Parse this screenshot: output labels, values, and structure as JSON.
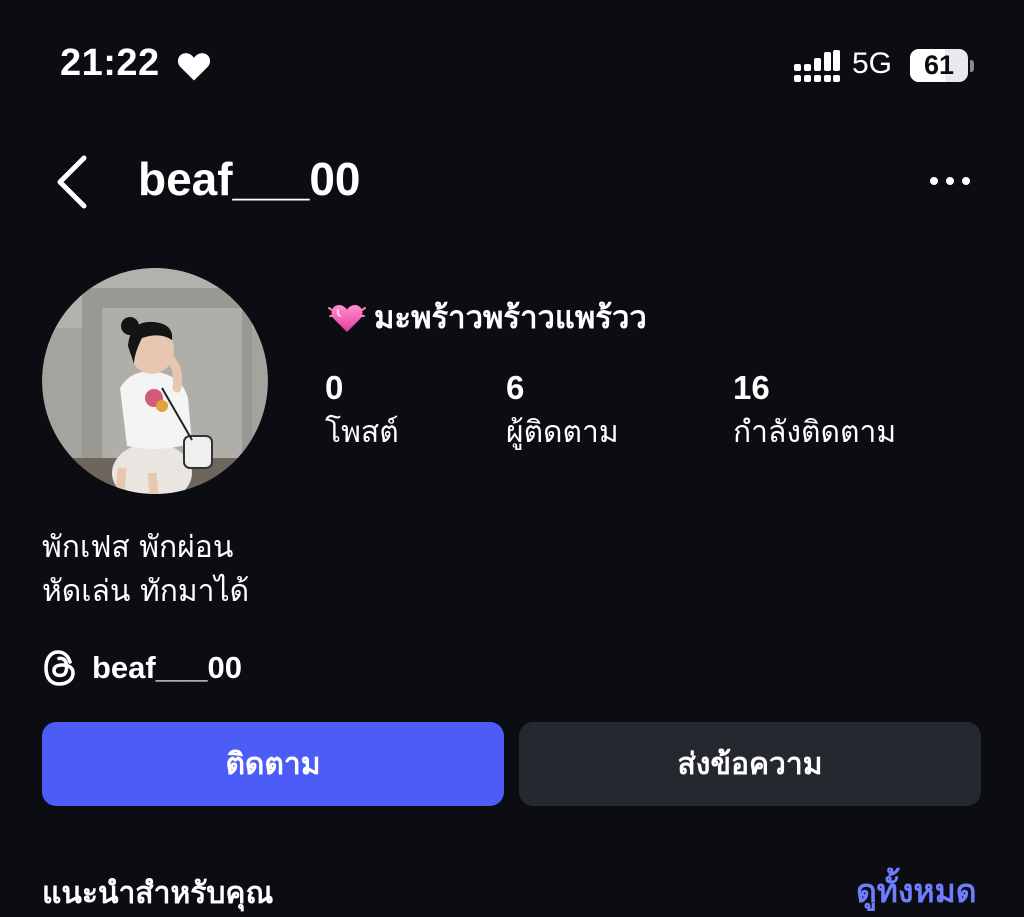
{
  "status_bar": {
    "time": "21:22",
    "heart_icon": "heart-icon",
    "signal_icon": "cellular-signal-icon",
    "network": "5G",
    "battery_level": 61,
    "battery_label": "61"
  },
  "header": {
    "back_icon": "chevron-left-icon",
    "username": "beaf___00",
    "more_icon": "more-horizontal-icon"
  },
  "profile": {
    "avatar_icon": "profile-photo",
    "name_emoji": "💓",
    "display_name": "มะพร้าวพร้าวแพร้วว",
    "stats": {
      "posts": {
        "value": "0",
        "label": "โพสต์"
      },
      "followers": {
        "value": "6",
        "label": "ผู้ติดตาม"
      },
      "following": {
        "value": "16",
        "label": "กำลังติดตาม"
      }
    },
    "bio_lines": [
      "พักเฟส พักผ่อน",
      "หัดเล่น ทักมาได้"
    ],
    "threads_icon": "threads-icon",
    "threads_handle": "beaf___00"
  },
  "actions": {
    "follow_label": "ติดตาม",
    "message_label": "ส่งข้อความ"
  },
  "suggested": {
    "title": "แนะนำสำหรับคุณ",
    "see_all_label": "ดูทั้งหมด"
  },
  "colors": {
    "background": "#0c0d13",
    "accent": "#4c5cf7",
    "secondary_button": "#262830",
    "link": "#6f7dff"
  }
}
